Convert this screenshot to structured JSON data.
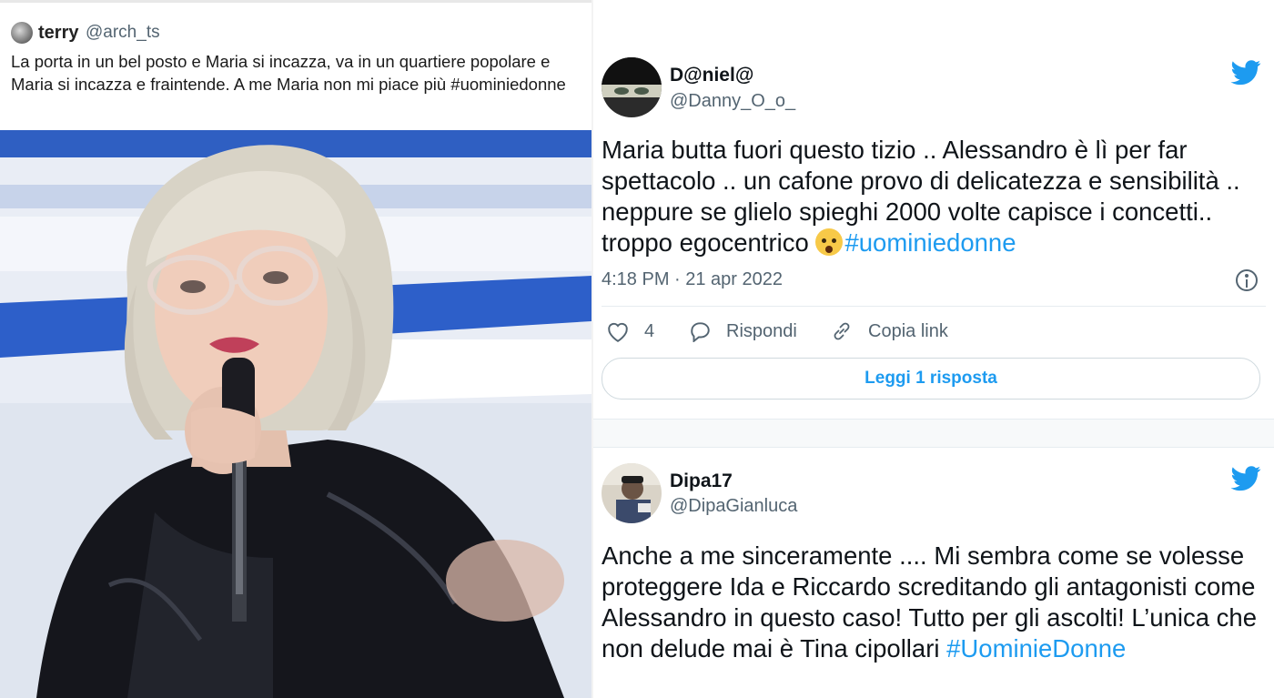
{
  "left_tweet": {
    "author_name": "terry",
    "handle": "@arch_ts",
    "text": "La porta in un bel posto e Maria si incazza, va in un quartiere popolare e Maria si incazza e fraintende. A me Maria non mi piace più #uominiedonne"
  },
  "tweet1": {
    "author_name": "D@niel@",
    "handle": "@Danny_O_o_",
    "text_before": "Maria butta fuori questo tizio .. Alessandro è lì per far spettacolo .. un cafone provo di delicatezza e sensibilità .. neppure se glielo spieghi 2000 volte capisce i concetti.. troppo egocentrico ",
    "emoji": "exploding-head-emoji",
    "hashtag": "#uominiedonne",
    "timestamp": "4:18 PM · 21 apr 2022",
    "likes": "4",
    "reply_label": "Rispondi",
    "copy_link_label": "Copia link",
    "read_replies_label": "Leggi 1 risposta"
  },
  "tweet2": {
    "author_name": "Dipa17",
    "handle": "@DipaGianluca",
    "text_before": "Anche a me sinceramente .... Mi sembra come se volesse proteggere Ida e Riccardo screditando gli antagonisti come Alessandro in questo caso! Tutto per gli ascolti! L’unica che non delude mai è Tina cipollari ",
    "hashtag": "#UominieDonne"
  },
  "colors": {
    "twitter_blue": "#1d9bf0",
    "text_secondary": "#536471",
    "text_primary": "#0f1419"
  },
  "icons": [
    "twitter-bird-icon",
    "info-icon",
    "heart-icon",
    "reply-icon",
    "link-icon"
  ]
}
